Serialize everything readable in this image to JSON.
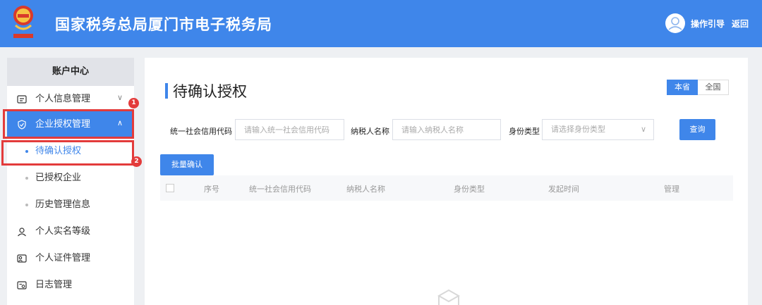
{
  "header": {
    "title": "国家税务总局厦门市电子税务局",
    "guide_label": "操作引导",
    "back_label": "返回"
  },
  "sidebar": {
    "heading": "账户中心",
    "items": [
      {
        "label": "个人信息管理",
        "icon": "id-card-icon"
      },
      {
        "label": "企业授权管理",
        "icon": "shield-check-icon"
      },
      {
        "label": "待确认授权"
      },
      {
        "label": "已授权企业"
      },
      {
        "label": "历史管理信息"
      },
      {
        "label": "个人实名等级",
        "icon": "user-level-icon"
      },
      {
        "label": "个人证件管理",
        "icon": "certificate-icon"
      },
      {
        "label": "日志管理",
        "icon": "log-icon"
      }
    ],
    "callouts": [
      "1",
      "2"
    ]
  },
  "main": {
    "title": "待确认授权",
    "scope": {
      "province": "本省",
      "national": "全国"
    },
    "filters": {
      "credit_code_label": "统一社会信用代码",
      "credit_code_placeholder": "请输入统一社会信用代码",
      "taxpayer_label": "纳税人名称",
      "taxpayer_placeholder": "请输入纳税人名称",
      "identity_label": "身份类型",
      "identity_placeholder": "请选择身份类型"
    },
    "query_label": "查询",
    "batch_confirm_label": "批量确认",
    "table": {
      "columns": [
        "序号",
        "统一社会信用代码",
        "纳税人名称",
        "身份类型",
        "发起时间",
        "管理"
      ]
    }
  },
  "colors": {
    "accent": "#3f86ea",
    "highlight": "#e33b3b"
  }
}
